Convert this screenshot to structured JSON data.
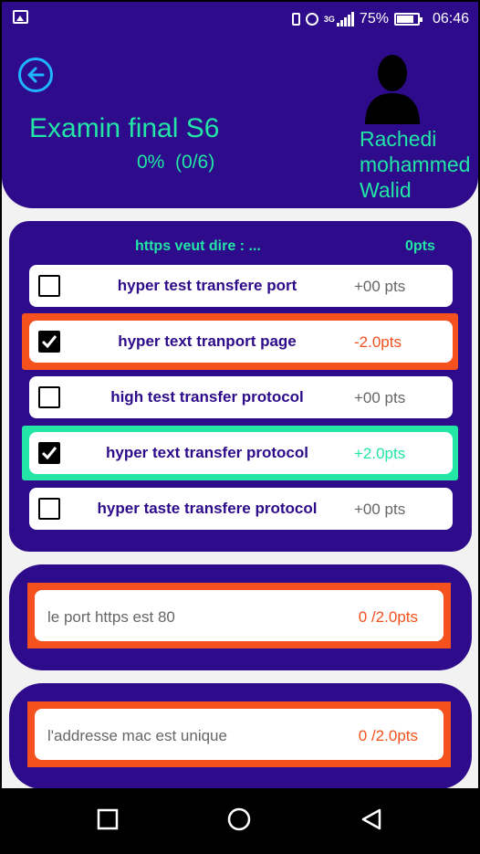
{
  "status_bar": {
    "network": "3G",
    "battery": "75%",
    "time": "06:46"
  },
  "header": {
    "title": "Examin final S6",
    "progress": "0%  (0/6)",
    "student_name": [
      "Rachedi",
      "mohammed",
      "Walid"
    ]
  },
  "question": {
    "text": "https veut dire : ...",
    "points": "0pts",
    "options": [
      {
        "label": "hyper test transfere port",
        "points": "+00 pts",
        "checked": false,
        "state": "neutral"
      },
      {
        "label": "hyper text tranport page",
        "points": "-2.0pts",
        "checked": true,
        "state": "wrong"
      },
      {
        "label": "high test transfer protocol",
        "points": "+00 pts",
        "checked": false,
        "state": "neutral"
      },
      {
        "label": "hyper text transfer protocol",
        "points": "+2.0pts",
        "checked": true,
        "state": "correct"
      },
      {
        "label": "hyper taste transfere protocol",
        "points": "+00 pts",
        "checked": false,
        "state": "neutral"
      }
    ]
  },
  "true_false": [
    {
      "statement": "le port https est 80",
      "score": "0 /2.0pts"
    },
    {
      "statement": "l'addresse mac est unique",
      "score": "0 /2.0pts"
    }
  ],
  "colors": {
    "primary": "#2d0b8a",
    "accent": "#22e5a6",
    "wrong": "#f4511e",
    "correct": "#22e5a6",
    "back_icon": "#1fb6ff"
  }
}
